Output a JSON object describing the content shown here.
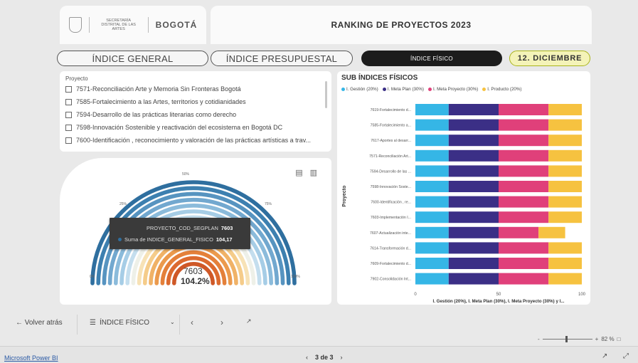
{
  "header": {
    "logo_small_text": "SECRETARÍA DISTRITAL DE LAS ARTES",
    "logo_brand": "BOGOTÁ",
    "title": "RANKING DE PROYECTOS 2023"
  },
  "tabs": [
    {
      "label": "ÍNDICE GENERAL"
    },
    {
      "label": "ÍNDICE PRESUPUESTAL"
    },
    {
      "label": "ÍNDICE FÍSICO"
    },
    {
      "label": "12. DICIEMBRE"
    }
  ],
  "slicer": {
    "header": "Proyecto",
    "items": [
      "7571-Reconciliación Arte y Memoria Sin Fronteras Bogotá",
      "7585-Fortalecimiento a las Artes, territorios y cotidianidades",
      "7594-Desarrollo de las prácticas literarias como derecho",
      "7598-Innovación Sostenible y reactivación del ecosistema en Bogotá DC",
      "7600-Identificación , reconocimiento y valoración de las prácticas artísticas a trav..."
    ]
  },
  "donut": {
    "labels": {
      "p0": "0%",
      "p25": "25%",
      "p50": "50%",
      "p75": "75%",
      "p100": "100%"
    },
    "tooltip": {
      "key1": "PROYECTO_COD_SEGPLAN",
      "val1": "7603",
      "key2": "Suma de INDICE_GENERAL_FISICO",
      "val2": "104,17"
    },
    "center_code": "7603",
    "center_pct": "104.2%",
    "ring_colors": [
      "#2f6f9f",
      "#3d80b0",
      "#5794c0",
      "#72a8cf",
      "#8bbbdb",
      "#a6cde6",
      "#c4deee",
      "#eef0e8",
      "#f7e2b6",
      "#f5cc8a",
      "#f0b267",
      "#eb9a4d",
      "#e4803a",
      "#dc6a2f",
      "#cf5827"
    ]
  },
  "chart_data": {
    "type": "bar",
    "title": "SUB ÍNDICES FÍSICOS",
    "ylabel": "Proyecto",
    "xlabel": "I. Gestión (20%), I. Meta Plan (30%), I. Meta Proyecto (30%) y I...",
    "xlim": [
      0,
      100
    ],
    "xticks": [
      "0",
      "50",
      "100"
    ],
    "stacked": true,
    "categories": [
      "7619-Fortalecimiento d...",
      "7585-Fortalecimiento a...",
      "7617-Aportes al desarr...",
      "7571-Reconciliación Art...",
      "7594-Desarrollo de las ...",
      "7598-Innovación Soste...",
      "7600-Identificación , re...",
      "7603-Implementación I...",
      "7607-Actualización inte...",
      "7614-Transformación d...",
      "7609-Fortalecimiento d...",
      "7902-Consolidación Int..."
    ],
    "series": [
      {
        "name": "I. Gestión (20%)",
        "color": "#35b6e6",
        "values": [
          20,
          20,
          20,
          20,
          20,
          20,
          20,
          20,
          20,
          20,
          20,
          20
        ]
      },
      {
        "name": "I. Meta Plan (30%)",
        "color": "#3b2f86",
        "values": [
          30,
          30,
          30,
          30,
          30,
          30,
          30,
          30,
          30,
          30,
          30,
          30
        ]
      },
      {
        "name": "I. Meta Proyecto (30%)",
        "color": "#e0407a",
        "values": [
          30,
          30,
          30,
          30,
          30,
          30,
          30,
          30,
          24,
          30,
          30,
          30
        ]
      },
      {
        "name": "I. Producto (20%)",
        "color": "#f6c240",
        "values": [
          20,
          20,
          20,
          20,
          20,
          20,
          20,
          20,
          16,
          20,
          20,
          20
        ]
      }
    ]
  },
  "navigation": {
    "back_label": "Volver atrás",
    "page_label": "ÍNDICE FÍSICO",
    "page_menu_icon": "hamburger-icon",
    "dropdown_icon": "chevron-down-icon"
  },
  "status": {
    "app_link": "Microsoft Power BI",
    "page_indicator": "3 de 3",
    "zoom": "82 %"
  }
}
